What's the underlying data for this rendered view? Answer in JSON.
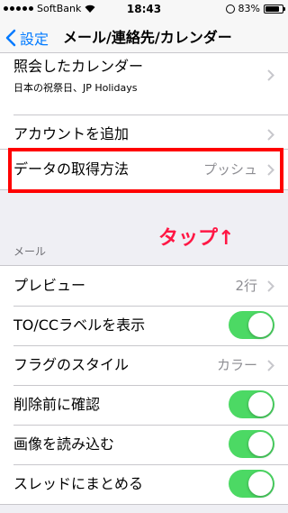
{
  "status_bar": {
    "carrier": "SoftBank",
    "time": "18:43",
    "battery": "83%",
    "battery_level": 0.83
  },
  "nav": {
    "back_label": "設定",
    "title": "メール/連絡先/カレンダー"
  },
  "calendar_group": {
    "subscribed": {
      "label": "照会したカレンダー",
      "sub": "日本の祝祭日、JP Holidays"
    },
    "add_account": {
      "label": "アカウントを追加"
    }
  },
  "fetch_group": {
    "fetch": {
      "label": "データの取得方法",
      "value": "プッシュ"
    }
  },
  "annotation": {
    "text": "タップ↑",
    "color": "#ff0000"
  },
  "mail_section": {
    "header": "メール",
    "preview": {
      "label": "プレビュー",
      "value": "2行"
    },
    "show_to_cc": {
      "label": "TO/CCラベルを表示",
      "on": true
    },
    "flag_style": {
      "label": "フラグのスタイル",
      "value": "カラー"
    },
    "ask_before_delete": {
      "label": "削除前に確認",
      "on": true
    },
    "load_images": {
      "label": "画像を読み込む",
      "on": true
    },
    "organize_by_thread": {
      "label": "スレッドにまとめる",
      "on": true
    }
  },
  "colors": {
    "tint": "#007aff",
    "toggle_on": "#4cd964",
    "secondary_text": "#8e8e93"
  }
}
